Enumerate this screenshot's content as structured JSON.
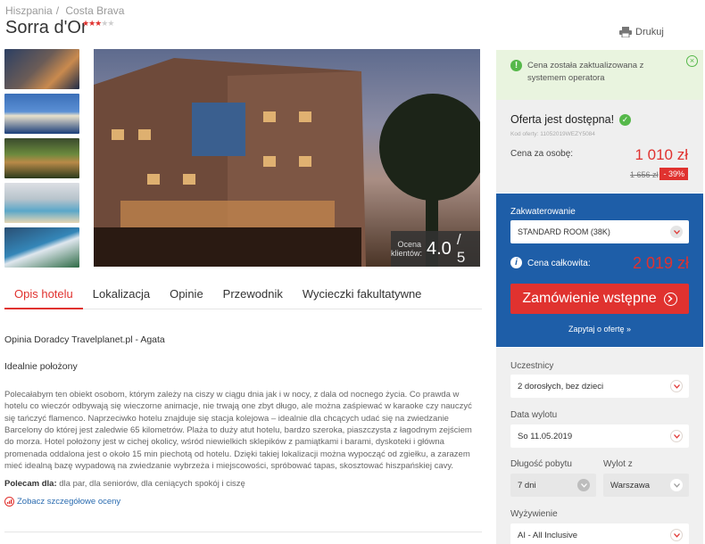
{
  "breadcrumb": {
    "country": "Hiszpania",
    "separator": "/",
    "region": "Costa Brava"
  },
  "hotel": {
    "name": "Sorra d'Or",
    "stars": 3,
    "max_stars": 5
  },
  "print_label": "Drukuj",
  "photos": {
    "thumbnails": [
      "hotel-exterior-dusk",
      "marina-boats",
      "pool-palms-night",
      "courtyard-pool",
      "swimming-pool"
    ],
    "rating_label": "Ocena klientów:",
    "rating_value": "4.0",
    "rating_max": "/ 5"
  },
  "tabs": [
    "Opis hotelu",
    "Lokalizacja",
    "Opinie",
    "Przewodnik",
    "Wycieczki fakultatywne"
  ],
  "active_tab": 0,
  "description": {
    "author": "Opinia Doradcy Travelplanet.pl - Agata",
    "heading": "Idealnie położony",
    "body": "Polecałabym ten obiekt osobom, którym zależy na ciszy w ciągu dnia jak i w nocy, z dala od nocnego życia. Co prawda w hotelu co wieczór odbywają się wieczorne animacje, nie trwają one zbyt długo, ale można zaśpiewać w karaoke czy nauczyć się tańczyć flamenco. Naprzeciwko hotelu znajduje się stacja kolejowa – idealnie dla chcących udać się na zwiedzanie Barcelony do której jest zaledwie 65 kilometrów. Plaża to duży atut hotelu, bardzo szeroka, piaszczysta z łagodnym zejściem do morza. Hotel położony jest w cichej okolicy, wśród niewielkich sklepików z pamiątkami i barami, dyskoteki i główna promenada oddalona jest o około 15 min piechotą od hotelu. Dzięki takiej lokalizacji można wypocząć od zgiełku, a zarazem mieć idealną bazę wypadową na zwiedzanie wybrzeża i miejscowości, spróbować tapas, skosztować hiszpańskiej cavy.",
    "recommended_label": "Polecam dla:",
    "recommended_value": "dla par, dla seniorów, dla ceniących spokój i ciszę",
    "more_link": "Zobacz szczegółowe oceny"
  },
  "notification": {
    "text": "Cena została zaktualizowana z systemem operatora"
  },
  "offer": {
    "status": "Oferta jest dostępna!",
    "code": "Kod oferty: 11052019WEZY5084",
    "per_person_label": "Cena za osobę:",
    "price": "1 010 zł",
    "old_price": "1 656 zł",
    "discount": "- 39%"
  },
  "booking": {
    "accommodation_label": "Zakwaterowanie",
    "accommodation_value": "STANDARD ROOM (38K)",
    "total_label": "Cena całkowita:",
    "total": "2 019 zł",
    "order_button": "Zamówienie wstępne",
    "ask_link": "Zapytaj o ofertę »"
  },
  "filters": {
    "participants_label": "Uczestnicy",
    "participants_value": "2 dorosłych, bez dzieci",
    "departure_label": "Data wylotu",
    "departure_value": "So 11.05.2019",
    "duration_label": "Długość pobytu",
    "duration_value": "7 dni",
    "from_label": "Wylot z",
    "from_value": "Warszawa",
    "board_label": "Wyżywienie",
    "board_value": "AI - All Inclusive"
  },
  "colors": {
    "accent": "#e0322f",
    "primary": "#1e5ea8",
    "success": "#56b84a"
  }
}
